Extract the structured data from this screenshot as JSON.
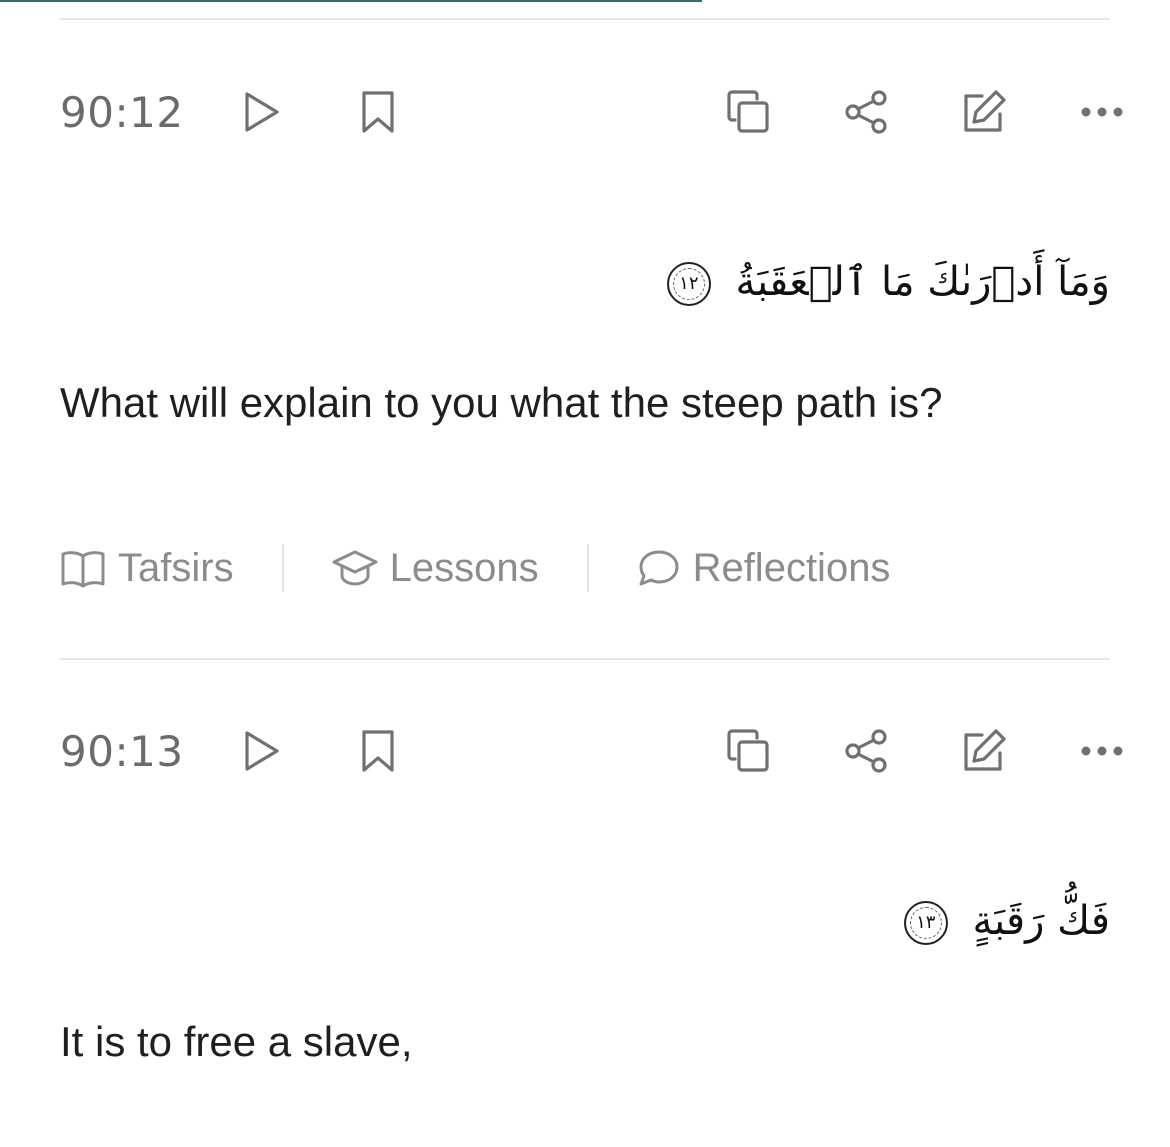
{
  "progress": {
    "fraction": 0.6,
    "color": "#2f6e73"
  },
  "icons": {
    "play": "play-icon",
    "bookmark": "bookmark-icon",
    "copy": "copy-icon",
    "share": "share-icon",
    "edit": "edit-icon",
    "more": "more-icon"
  },
  "verses": [
    {
      "key": "90:12",
      "arabic": "وَمَآ أَدۡرَىٰكَ مَا ٱلۡعَقَبَةُ",
      "ayah_number": "١٢",
      "translation": "What will explain to you what the steep path is?",
      "tabs": [
        {
          "label": "Tafsirs",
          "icon": "book-icon"
        },
        {
          "label": "Lessons",
          "icon": "graduation-cap-icon"
        },
        {
          "label": "Reflections",
          "icon": "chat-bubble-icon"
        }
      ]
    },
    {
      "key": "90:13",
      "arabic": "فَكُّ رَقَبَةٍ",
      "ayah_number": "١٣",
      "translation": "It is to free a slave,"
    }
  ]
}
